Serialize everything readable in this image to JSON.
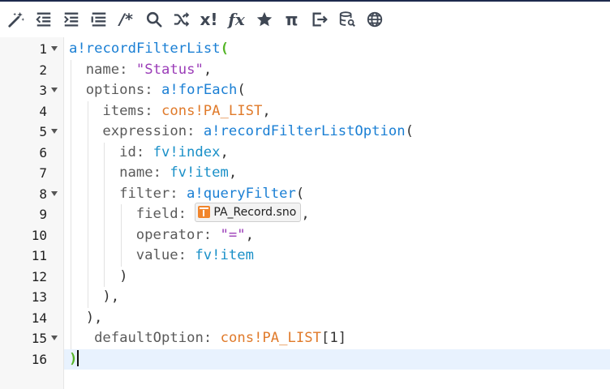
{
  "toolbar": {
    "buttons": [
      {
        "name": "magic-wand-icon",
        "kind": "svg"
      },
      {
        "name": "outdent-icon",
        "kind": "svg"
      },
      {
        "name": "indent-icon",
        "kind": "svg"
      },
      {
        "name": "align-lines-icon",
        "kind": "svg"
      },
      {
        "name": "comment-icon",
        "label": "/*"
      },
      {
        "name": "search-icon",
        "kind": "svg"
      },
      {
        "name": "shuffle-icon",
        "kind": "svg"
      },
      {
        "name": "local-variable-icon",
        "label": "x!"
      },
      {
        "name": "function-icon",
        "label": "fx"
      },
      {
        "name": "star-icon",
        "kind": "svg"
      },
      {
        "name": "pi-constant-icon",
        "label": "π"
      },
      {
        "name": "export-icon",
        "kind": "svg"
      },
      {
        "name": "database-search-icon",
        "kind": "svg"
      },
      {
        "name": "globe-icon",
        "kind": "svg"
      }
    ]
  },
  "editor": {
    "active_line": 16,
    "lines": [
      {
        "n": "1",
        "fold": true,
        "indent": 0,
        "tokens": [
          [
            "kw",
            "a!recordFilterList"
          ],
          [
            "brk",
            "("
          ]
        ]
      },
      {
        "n": "2",
        "fold": false,
        "indent": 1,
        "tokens": [
          [
            "key",
            "name: "
          ],
          [
            "str",
            "\"Status\""
          ],
          [
            "pun",
            ","
          ]
        ]
      },
      {
        "n": "3",
        "fold": true,
        "indent": 1,
        "tokens": [
          [
            "key",
            "options: "
          ],
          [
            "kw",
            "a!forEach"
          ],
          [
            "pun",
            "("
          ]
        ]
      },
      {
        "n": "4",
        "fold": false,
        "indent": 2,
        "tokens": [
          [
            "key",
            "items: "
          ],
          [
            "cons",
            "cons!PA_LIST"
          ],
          [
            "pun",
            ","
          ]
        ]
      },
      {
        "n": "5",
        "fold": true,
        "indent": 2,
        "tokens": [
          [
            "key",
            "expression: "
          ],
          [
            "kw",
            "a!recordFilterListOption"
          ],
          [
            "pun",
            "("
          ]
        ]
      },
      {
        "n": "6",
        "fold": false,
        "indent": 3,
        "tokens": [
          [
            "key",
            "id: "
          ],
          [
            "fv",
            "fv!index"
          ],
          [
            "pun",
            ","
          ]
        ]
      },
      {
        "n": "7",
        "fold": false,
        "indent": 3,
        "tokens": [
          [
            "key",
            "name: "
          ],
          [
            "fv",
            "fv!item"
          ],
          [
            "pun",
            ","
          ]
        ]
      },
      {
        "n": "8",
        "fold": true,
        "indent": 3,
        "tokens": [
          [
            "key",
            "filter: "
          ],
          [
            "kw",
            "a!queryFilter"
          ],
          [
            "pun",
            "("
          ]
        ]
      },
      {
        "n": "9",
        "fold": false,
        "indent": 4,
        "tokens": [
          [
            "key",
            "field: "
          ],
          [
            "chip",
            "PA_Record.sno"
          ],
          [
            "pun",
            ","
          ]
        ]
      },
      {
        "n": "10",
        "fold": false,
        "indent": 4,
        "tokens": [
          [
            "key",
            "operator: "
          ],
          [
            "str",
            "\"=\""
          ],
          [
            "pun",
            ","
          ]
        ]
      },
      {
        "n": "11",
        "fold": false,
        "indent": 4,
        "tokens": [
          [
            "key",
            "value: "
          ],
          [
            "fv",
            "fv!item"
          ]
        ]
      },
      {
        "n": "12",
        "fold": false,
        "indent": 3,
        "tokens": [
          [
            "pun",
            ")"
          ]
        ]
      },
      {
        "n": "13",
        "fold": false,
        "indent": 2,
        "tokens": [
          [
            "pun",
            "),"
          ]
        ]
      },
      {
        "n": "14",
        "fold": false,
        "indent": 1,
        "tokens": [
          [
            "pun",
            "),"
          ]
        ]
      },
      {
        "n": "15",
        "fold": true,
        "indent": 1,
        "tokens": [
          [
            "pun",
            " "
          ],
          [
            "key",
            "defaultOption: "
          ],
          [
            "cons",
            "cons!PA_LIST"
          ],
          [
            "pun",
            "[1]"
          ]
        ]
      },
      {
        "n": "16",
        "fold": false,
        "indent": 0,
        "tokens": [
          [
            "brk",
            ")"
          ],
          [
            "cursor",
            ""
          ]
        ]
      }
    ]
  }
}
